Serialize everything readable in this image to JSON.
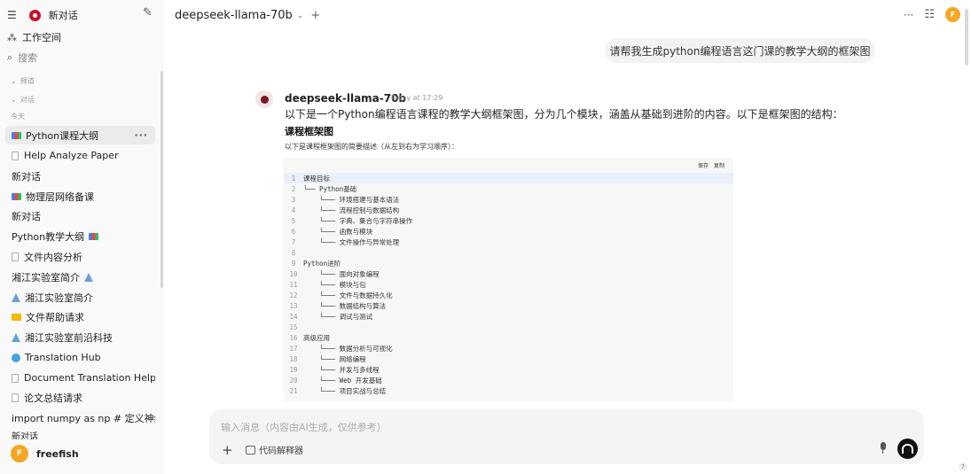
{
  "sidebar": {
    "new_chat_label": "新对话",
    "workspace_label": "工作空间",
    "search_label": "搜索",
    "channels_label": "频道",
    "chats_label": "对话",
    "today_label": "今天",
    "items": [
      {
        "label": "Python课程大纲",
        "icon": "books-icon",
        "active": true,
        "more": "···"
      },
      {
        "label": "Help Analyze Paper",
        "icon": "document-icon"
      },
      {
        "label": "新对话",
        "icon": ""
      },
      {
        "label": "物理层网络备课",
        "icon": "books-icon"
      },
      {
        "label": "新对话",
        "icon": ""
      },
      {
        "label": "Python教学大纲",
        "icon": "books-icon-trailing"
      },
      {
        "label": "文件内容分析",
        "icon": "document-icon"
      },
      {
        "label": "湘江实验室简介",
        "icon": "flask-icon-trailing"
      },
      {
        "label": "湘江实验室简介",
        "icon": "flask-icon"
      },
      {
        "label": "文件帮助请求",
        "icon": "folder-icon"
      },
      {
        "label": "湘江实验室前沿科技",
        "icon": "flask-icon"
      },
      {
        "label": "Translation Hub",
        "icon": "globe-icon"
      },
      {
        "label": "Document Translation Help",
        "icon": "document-icon"
      },
      {
        "label": "论文总结请求",
        "icon": "document-icon"
      },
      {
        "label": "import numpy as np # 定义神经网",
        "icon": ""
      },
      {
        "label": "新对话",
        "icon": ""
      }
    ],
    "user": {
      "initial": "F",
      "name": "freefish"
    }
  },
  "header": {
    "model": "deepseek-llama-70b",
    "add": "+",
    "more": "···",
    "user_initial": "F"
  },
  "chat": {
    "user_message": "请帮我生成python编程语言这门课的教学大纲的框架图",
    "assistant_name": "deepseek-llama-70b",
    "assistant_time": "Today at 17:29",
    "intro": "以下是一个Python编程语言课程的教学大纲框架图，分为几个模块，涵盖从基础到进阶的内容。以下是框架图的结构：",
    "heading": "课程框架图",
    "description": "以下是课程框架图的简要描述（从左到右为学习顺序）：",
    "code_save": "保存",
    "code_copy": "复制",
    "code_lines": [
      "课程目标",
      "└── Python基础",
      "    └─── 环境搭建与基本语法",
      "    └─── 流程控制与数据结构",
      "    └─── 字典、集合与字符串操作",
      "    └─── 函数与模块",
      "    └─── 文件操作与异常处理",
      "",
      "Python进阶",
      "    └─── 面向对象编程",
      "    └─── 模块与包",
      "    └─── 文件与数据持久化",
      "    └─── 数据结构与算法",
      "    └─── 调试与测试",
      "",
      "高级应用",
      "    └─── 数据分析与可视化",
      "    └─── 网络编程",
      "    └─── 并发与多线程",
      "    └─── Web 开发基础",
      "    └─── 项目实战与总结"
    ]
  },
  "input": {
    "placeholder": "输入消息（内容由AI生成，仅供参考）",
    "add": "+",
    "tool_label": "代码解释器"
  },
  "help": "?"
}
